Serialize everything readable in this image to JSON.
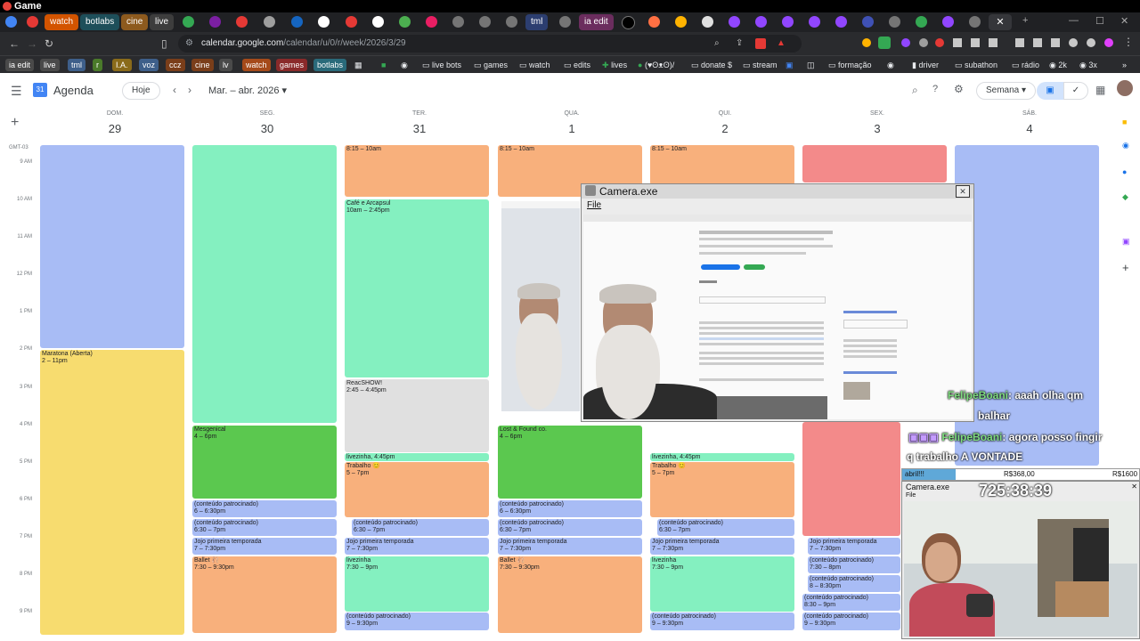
{
  "window": {
    "title": "Game"
  },
  "tabs": [
    {
      "label": "watch",
      "bg": "#d35400"
    },
    {
      "label": "botlabs",
      "bg": "#1e4f5a"
    },
    {
      "label": "cine",
      "bg": "#8d5a1e"
    },
    {
      "label": "live",
      "bg": "#3d3d3d"
    },
    {
      "label": "tml",
      "bg": "#2c3e70"
    },
    {
      "label": "ia edit",
      "bg": "#6b2d5e"
    }
  ],
  "address": {
    "url_host": "calendar.google.com",
    "url_path": "/calendar/u/0/r/week/2026/3/29"
  },
  "bookmark_tags": [
    {
      "label": "ia edit",
      "bg": "#4a4a4a"
    },
    {
      "label": "live",
      "bg": "#4a4a4a"
    },
    {
      "label": "tml",
      "bg": "#3e5f8a"
    },
    {
      "label": "r",
      "bg": "#4a7a2a"
    },
    {
      "label": "I.A.",
      "bg": "#8a6b1a"
    },
    {
      "label": "voz",
      "bg": "#3e5f8a"
    },
    {
      "label": "ccz",
      "bg": "#7a3e1a"
    },
    {
      "label": "cine",
      "bg": "#7a3e1a"
    },
    {
      "label": "lv",
      "bg": "#4a4a4a"
    },
    {
      "label": "watch",
      "bg": "#a54a1a"
    },
    {
      "label": "games",
      "bg": "#8a2a2a"
    },
    {
      "label": "botlabs",
      "bg": "#2a6a7a"
    }
  ],
  "bookmark_folders": [
    "live bots",
    "games",
    "watch",
    "edits",
    "lives",
    "(♥ʘᴥʘ)/",
    "donate $",
    "stream",
    "formação",
    "driver",
    "subathon",
    "rádio",
    "3x"
  ],
  "calendar": {
    "app_name": "Agenda",
    "today_label": "Hoje",
    "period_label": "Mar. – abr. 2026",
    "view_label": "Semana",
    "timezone": "GMT-03",
    "days": [
      {
        "name": "DOM.",
        "num": "29"
      },
      {
        "name": "SEG.",
        "num": "30"
      },
      {
        "name": "TER.",
        "num": "31"
      },
      {
        "name": "QUA.",
        "num": "1"
      },
      {
        "name": "QUI.",
        "num": "2"
      },
      {
        "name": "SEX.",
        "num": "3"
      },
      {
        "name": "SÁB.",
        "num": "4"
      }
    ],
    "hours": [
      "9 AM",
      "10 AM",
      "11 AM",
      "12 PM",
      "1 PM",
      "2 PM",
      "3 PM",
      "4 PM",
      "5 PM",
      "6 PM",
      "7 PM",
      "8 PM",
      "9 PM"
    ],
    "events": {
      "maratona": {
        "title": "Maratona (Aberta)",
        "time": "2 – 11pm"
      },
      "cafe": {
        "title": "Café e Arcapsul",
        "time": "10am – 2:45pm"
      },
      "react": {
        "title": "ReacSHOW!",
        "time": "2:45 – 4:45pm"
      },
      "mesgenical": {
        "title": "Mesgenical",
        "time": "4 – 6pm"
      },
      "lost": {
        "title": "Lost & Found co.",
        "time": "4 – 6pm"
      },
      "livezinha1": {
        "title": "livezinha",
        "time": "4:45pm"
      },
      "livezinha2": {
        "title": "livezinha",
        "time": "4:45pm"
      },
      "trabalho1": {
        "title": "Trabalho 😊",
        "time": "5 – 7pm"
      },
      "trabalho2": {
        "title": "Trabalho 😊",
        "time": "5 – 7pm"
      },
      "cont_a": {
        "title": "(conteúdo patrocinado)",
        "time": "6 – 6:30pm"
      },
      "cont_b": {
        "title": "(conteúdo patrocinado)",
        "time": "6:30 – 7pm"
      },
      "cont_c": {
        "title": "(conteúdo patrocinado)",
        "time": "6 – 6:30pm"
      },
      "cont_d": {
        "title": "(conteúdo patrocinado)",
        "time": "6:30 – 7pm"
      },
      "cont_e": {
        "title": "(conteúdo patrocinado)",
        "time": "6:30 – 7pm"
      },
      "cont_f": {
        "title": "(conteúdo patrocinado)",
        "time": "6:30 – 7pm"
      },
      "cont_g": {
        "title": "(conteúdo patrocinado)",
        "time": "7:30 – 8pm"
      },
      "cont_h": {
        "title": "(conteúdo patrocinado)",
        "time": "8 – 8:30pm"
      },
      "cont_i": {
        "title": "(conteúdo patrocinado)",
        "time": "8:30 – 9pm"
      },
      "cont_j": {
        "title": "(conteúdo patrocinado)",
        "time": "9 – 9:30pm"
      },
      "cont_k": {
        "title": "(conteúdo patrocinado)",
        "time": "9 – 9:30pm"
      },
      "cont_l": {
        "title": "(conteúdo patrocinado)",
        "time": "9 – 9:30pm"
      },
      "jojo": {
        "title": "Jojo primeira temporada",
        "time": "7 – 7:30pm"
      },
      "ballet": {
        "title": "Ballet 🩰",
        "time": "7:30 – 9:30pm"
      },
      "livezinha3": {
        "title": "livezinha",
        "time": "7:30 – 9pm"
      },
      "top1": {
        "title": "8:15 – 10am"
      }
    }
  },
  "camera_window": {
    "title": "Camera.exe",
    "menu": "File"
  },
  "chat": [
    {
      "user": "FelipeBoani",
      "text": ": aaah olha qm"
    },
    {
      "user": "",
      "text": "balhar"
    },
    {
      "user": "FelipeBoani",
      "text": ": agora posso fingir"
    },
    {
      "user": "",
      "text": "q trabalho A VONTADE"
    }
  ],
  "overlay": {
    "label": "abril!!!",
    "amount_left": "R$368,00",
    "amount_right": "R$1600",
    "timer": "725:38:39",
    "cam_title": "Camera.exe",
    "cam_menu": "File"
  },
  "colors": {
    "accent": "#1a73e8",
    "tml": "#2c3e70"
  }
}
